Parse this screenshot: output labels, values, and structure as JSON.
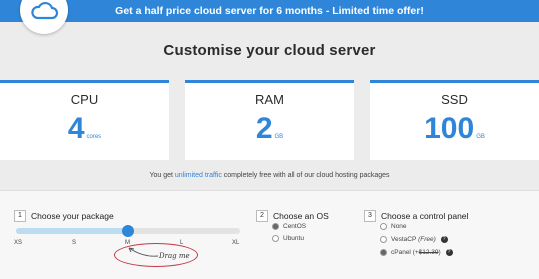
{
  "promo": {
    "text": "Get a half price cloud server for 6 months - Limited time offer!"
  },
  "logo": {
    "icon": "cloud-icon"
  },
  "page_title": "Customise your cloud server",
  "cards": [
    {
      "label": "CPU",
      "value": "4",
      "unit": "cores"
    },
    {
      "label": "RAM",
      "value": "2",
      "unit": "GB"
    },
    {
      "label": "SSD",
      "value": "100",
      "unit": "GB"
    }
  ],
  "note": {
    "before": "You get ",
    "highlight": "unlimited traffic",
    "after": " completely free with all of our cloud hosting packages"
  },
  "package": {
    "step": "1",
    "title": "Choose your package",
    "sizes": [
      "XS",
      "S",
      "M",
      "L",
      "XL"
    ],
    "selected": "M",
    "hint": "Drag me"
  },
  "os": {
    "step": "2",
    "title": "Choose an OS",
    "options": [
      {
        "label": "CentOS",
        "selected": true
      },
      {
        "label": "Ubuntu",
        "selected": false
      }
    ]
  },
  "control_panel": {
    "step": "3",
    "title": "Choose a control panel",
    "options": [
      {
        "label": "None",
        "selected": false
      },
      {
        "label": "VestaCP",
        "extra": "(Free)",
        "selected": false
      },
      {
        "label": "cPanel",
        "extra_prefix": "(+",
        "extra_price": "$12.39",
        "extra_suffix": ")",
        "selected": true
      }
    ]
  },
  "colors": {
    "accent": "#2f86d8",
    "highlight_ring": "#c03a4a"
  }
}
